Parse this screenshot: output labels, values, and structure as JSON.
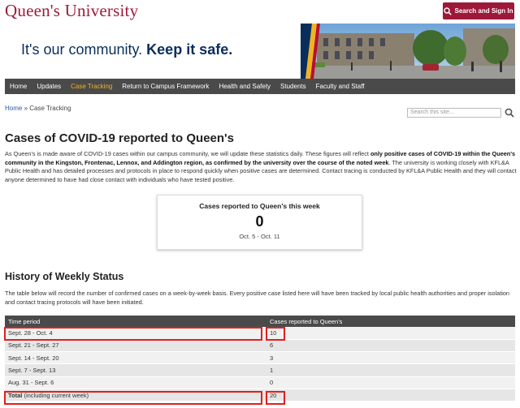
{
  "header": {
    "logo": "Queen's University",
    "signin_label": "Search and Sign In"
  },
  "banner": {
    "text_plain": "It's our community.",
    "text_bold": "Keep it safe."
  },
  "nav": {
    "items": [
      "Home",
      "Updates",
      "Case Tracking",
      "Return to Campus Framework",
      "Health and Safety",
      "Students",
      "Faculty and Staff"
    ],
    "active": "Case Tracking"
  },
  "breadcrumb": {
    "home": "Home",
    "sep": "»",
    "current": "Case Tracking"
  },
  "search": {
    "placeholder": "Search this site..."
  },
  "page_title": "Cases of COVID-19 reported to Queen's",
  "intro": {
    "p1": "As Queen's is made aware of COVID-19 cases within our campus community, we will update these statistics daily. These figures will reflect ",
    "b1": "only positive cases of COVID-19 within the Queen's community in the Kingston, Frontenac, Lennox, and Addington region, as confirmed by the university over the course of the noted week",
    "p2": ". The university is working closely with KFL&A Public Health and has detailed processes and protocols in place to respond quickly when positive cases are determined. Contact tracing is conducted by KFL&A Public Health and they will contact anyone determined to have had close contact with individuals who have tested positive."
  },
  "card": {
    "title": "Cases reported to Queen's this week",
    "value": "0",
    "range": "Oct. 5 - Oct. 11"
  },
  "history": {
    "title": "History of Weekly Status",
    "description": "The table below will record the number of confirmed cases on a week-by-week basis. Every positive case listed here will have been tracked by local public health authorities and proper isolation and contact tracing protocols will have been initiated.",
    "headers": [
      "Time period",
      "Cases reported to Queen's"
    ],
    "rows": [
      [
        "Sept. 28 - Oct. 4",
        "10"
      ],
      [
        "Sept. 21 - Sept. 27",
        "6"
      ],
      [
        "Sept. 14 - Sept. 20",
        "3"
      ],
      [
        "Sept. 7 - Sept. 13",
        "1"
      ],
      [
        "Aug. 31 - Sept. 6",
        "0"
      ]
    ],
    "total_label": "Total",
    "total_note": " (including current week)",
    "total_value": "20"
  },
  "colors": {
    "brand": "#9d1939",
    "nav_bg": "#4a4a4a",
    "nav_active": "#f0b323",
    "highlight": "#e0201e"
  }
}
